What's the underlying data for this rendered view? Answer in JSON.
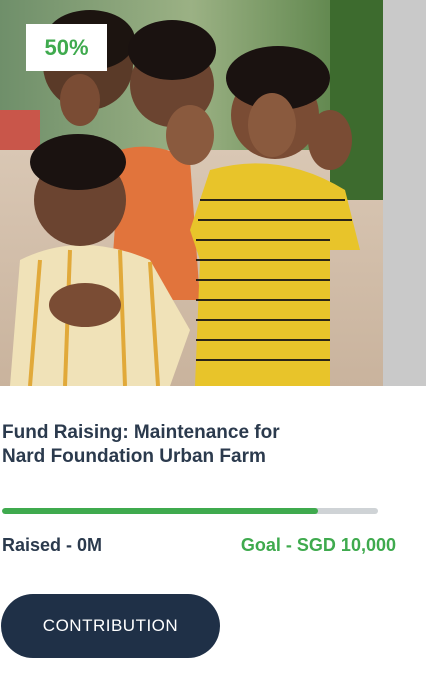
{
  "campaign": {
    "progress_badge": "50%",
    "progress_fraction": 0.84,
    "title_line1": "Fund Raising: Maintenance for",
    "title_line2": "Nard Foundation Urban Farm",
    "raised_text": "Raised - 0M",
    "goal_text": "Goal - SGD 10,000",
    "cta_label": "CONTRIBUTION"
  },
  "colors": {
    "accent_green": "#3faa4e",
    "navy": "#1f3047",
    "title_text": "#2b3a4d",
    "track_gray": "#cfd3d6"
  }
}
